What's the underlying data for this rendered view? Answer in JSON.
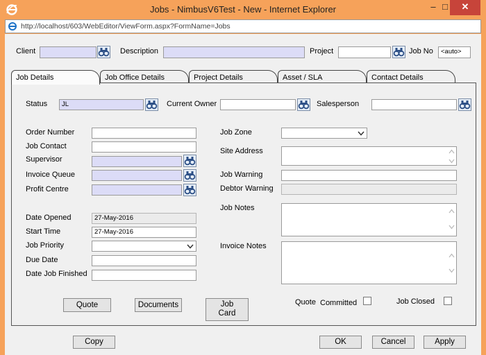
{
  "window": {
    "title": "Jobs - NimbusV6Test - New - Internet Explorer",
    "minimize": "–",
    "maximize": "□",
    "close": "✕",
    "address": "http://localhost/603/WebEditor/ViewForm.aspx?FormName=Jobs",
    "frame_color": "#f6a25a"
  },
  "header": {
    "client_label": "Client",
    "client_value": "",
    "description_label": "Description",
    "description_value": "",
    "project_label": "Project",
    "project_value": "",
    "jobno_label": "Job No",
    "jobno_value": "<auto>"
  },
  "tabs": [
    {
      "label": "Job Details",
      "active": true
    },
    {
      "label": "Job Office Details",
      "active": false
    },
    {
      "label": "Project Details",
      "active": false
    },
    {
      "label": "Asset / SLA",
      "active": false
    },
    {
      "label": "Contact Details",
      "active": false
    }
  ],
  "job_details": {
    "status_label": "Status",
    "status_value": "JL",
    "current_owner_label": "Current Owner",
    "current_owner_value": "",
    "salesperson_label": "Salesperson",
    "salesperson_value": "",
    "order_number_label": "Order Number",
    "job_contact_label": "Job Contact",
    "supervisor_label": "Supervisor",
    "invoice_queue_label": "Invoice Queue",
    "profit_centre_label": "Profit Centre",
    "date_opened_label": "Date Opened",
    "date_opened_value": "27-May-2016",
    "start_time_label": "Start Time",
    "start_time_value": "27-May-2016",
    "job_priority_label": "Job Priority",
    "job_priority_value": "",
    "due_date_label": "Due Date",
    "date_job_finished_label": "Date Job Finished",
    "job_zone_label": "Job Zone",
    "job_zone_value": "",
    "site_address_label": "Site Address",
    "job_warning_label": "Job Warning",
    "debtor_warning_label": "Debtor Warning",
    "job_notes_label": "Job Notes",
    "invoice_notes_label": "Invoice Notes",
    "quote_button": "Quote",
    "documents_button": "Documents",
    "job_card_line1": "Job",
    "job_card_line2": "Card",
    "quote_committed_label_1": "Quote",
    "quote_committed_label_2": "Committed",
    "job_closed_label": "Job Closed"
  },
  "footer": {
    "copy": "Copy",
    "ok": "OK",
    "cancel": "Cancel",
    "apply": "Apply"
  }
}
